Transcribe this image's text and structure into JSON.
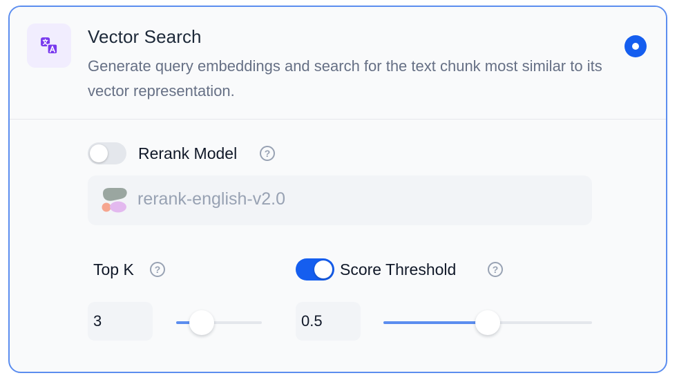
{
  "option": {
    "title": "Vector Search",
    "description": "Generate query embeddings and search for the text chunk most similar to its vector representation.",
    "selected": true,
    "icon": "translate-icon"
  },
  "rerank": {
    "label": "Rerank Model",
    "enabled": false,
    "help_icon": "question-circle-icon",
    "model_name": "rerank-english-v2.0",
    "model_icon": "cohere-logo-icon"
  },
  "top_k": {
    "label": "Top K",
    "help_icon": "question-circle-icon",
    "value": "3",
    "slider_fraction": 0.3
  },
  "score_threshold": {
    "label": "Score Threshold",
    "enabled": true,
    "help_icon": "question-circle-icon",
    "value": "0.5",
    "slider_fraction": 0.5
  },
  "colors": {
    "accent": "#155eef",
    "border": "#5b8def",
    "icon_bg": "#f1edfe",
    "icon_fg": "#7839ee"
  }
}
